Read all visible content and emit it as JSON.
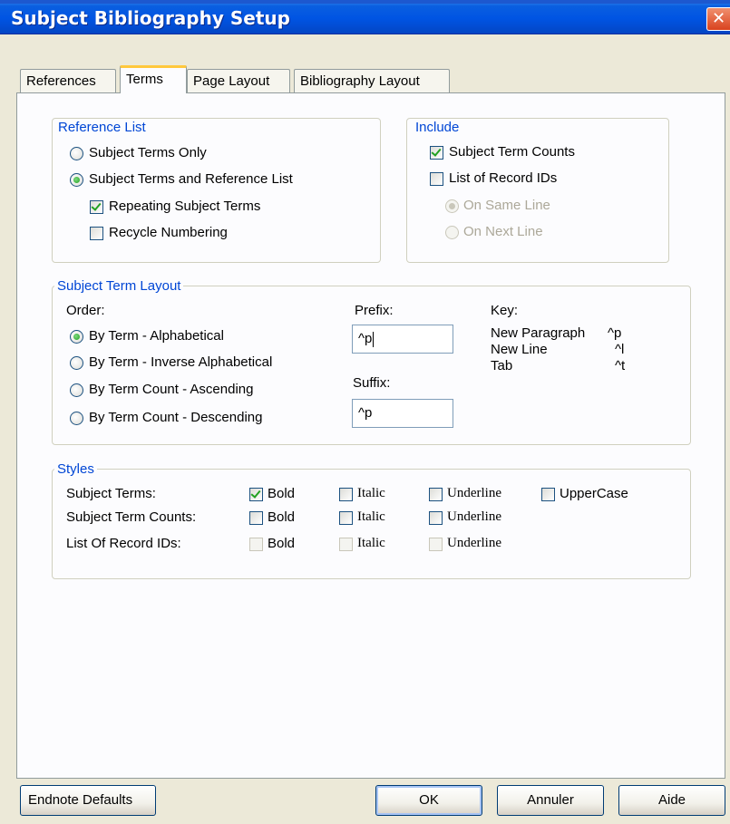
{
  "window": {
    "title": "Subject Bibliography Setup",
    "close_glyph": "✕"
  },
  "tabs": [
    {
      "label": "References"
    },
    {
      "label": "Terms"
    },
    {
      "label": "Page Layout"
    },
    {
      "label": "Bibliography Layout"
    }
  ],
  "reference_list": {
    "title": "Reference List",
    "subject_terms_only": "Subject Terms Only",
    "subject_terms_and_ref_list": "Subject Terms and Reference List",
    "repeating_subject_terms": "Repeating Subject Terms",
    "recycle_numbering": "Recycle Numbering"
  },
  "include": {
    "title": "Include",
    "subject_term_counts": "Subject Term Counts",
    "list_of_record_ids": "List of Record IDs",
    "on_same_line": "On Same Line",
    "on_next_line": "On Next Line"
  },
  "layout": {
    "title": "Subject Term Layout",
    "order_label": "Order:",
    "orders": [
      "By Term - Alphabetical",
      "By Term - Inverse Alphabetical",
      "By Term Count - Ascending",
      "By Term Count - Descending"
    ],
    "prefix_label": "Prefix:",
    "prefix_value": "^p",
    "suffix_label": "Suffix:",
    "suffix_value": "^p",
    "key_label": "Key:",
    "keys": [
      {
        "name": "New Paragraph",
        "code": "^p"
      },
      {
        "name": "New Line",
        "code": "^l"
      },
      {
        "name": "Tab",
        "code": "^t"
      }
    ]
  },
  "styles": {
    "title": "Styles",
    "rows": [
      {
        "label": "Subject Terms:"
      },
      {
        "label": "Subject Term Counts:"
      },
      {
        "label": "List Of Record IDs:"
      }
    ],
    "bold": "Bold",
    "italic": "Italic",
    "underline": "Underline",
    "uppercase": "UpperCase"
  },
  "buttons": {
    "endnote_defaults": "Endnote Defaults",
    "ok": "OK",
    "cancel": "Annuler",
    "help": "Aide"
  }
}
